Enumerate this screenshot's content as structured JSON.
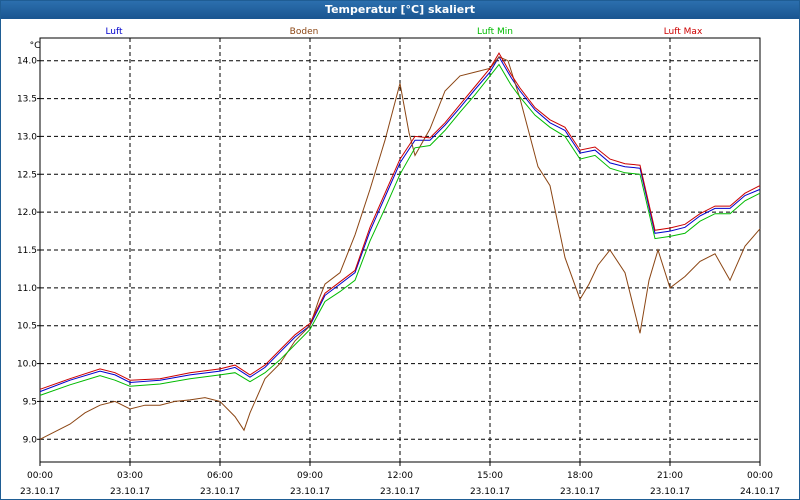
{
  "window": {
    "title": "Temperatur [°C] skaliert"
  },
  "chart_data": {
    "type": "line",
    "title": "Temperatur [°C] skaliert",
    "ylabel": "°C",
    "ylim": [
      8.7,
      14.3
    ],
    "y_ticks": [
      {
        "value": 9.0,
        "label": "9.0"
      },
      {
        "value": 9.5,
        "label": "9.5"
      },
      {
        "value": 10.0,
        "label": "10.0"
      },
      {
        "value": 10.5,
        "label": "10.5"
      },
      {
        "value": 11.0,
        "label": "11.0"
      },
      {
        "value": 11.5,
        "label": "11.5"
      },
      {
        "value": 12.0,
        "label": "12.0"
      },
      {
        "value": 12.5,
        "label": "12.5"
      },
      {
        "value": 13.0,
        "label": "13.0"
      },
      {
        "value": 13.5,
        "label": "13.5"
      },
      {
        "value": 14.0,
        "label": "14.0"
      }
    ],
    "xlim": [
      0,
      24
    ],
    "x_ticks": [
      {
        "hour": 0,
        "time": "00:00",
        "date": "23.10.17"
      },
      {
        "hour": 3,
        "time": "03:00",
        "date": "23.10.17"
      },
      {
        "hour": 6,
        "time": "06:00",
        "date": "23.10.17"
      },
      {
        "hour": 9,
        "time": "09:00",
        "date": "23.10.17"
      },
      {
        "hour": 12,
        "time": "12:00",
        "date": "23.10.17"
      },
      {
        "hour": 15,
        "time": "15:00",
        "date": "23.10.17"
      },
      {
        "hour": 18,
        "time": "18:00",
        "date": "23.10.17"
      },
      {
        "hour": 21,
        "time": "21:00",
        "date": "23.10.17"
      },
      {
        "hour": 24,
        "time": "00:00",
        "date": "24.10.17"
      }
    ],
    "grid": true,
    "legend_position": "top",
    "series": [
      {
        "name": "Luft",
        "color": "#0000cc",
        "x": [
          0,
          1,
          2,
          2.5,
          3,
          4,
          5,
          6,
          6.5,
          7,
          7.5,
          8,
          8.5,
          9,
          9.5,
          10,
          10.5,
          11,
          11.5,
          12,
          12.5,
          13,
          13.5,
          14,
          14.5,
          15,
          15.3,
          15.7,
          16,
          16.5,
          17,
          17.5,
          18,
          18.5,
          19,
          19.5,
          20,
          20.5,
          21,
          21.5,
          22,
          22.5,
          23,
          23.5,
          24
        ],
        "y": [
          9.63,
          9.78,
          9.9,
          9.85,
          9.75,
          9.78,
          9.85,
          9.9,
          9.95,
          9.82,
          9.95,
          10.15,
          10.35,
          10.5,
          10.9,
          11.05,
          11.2,
          11.75,
          12.2,
          12.65,
          12.95,
          12.95,
          13.15,
          13.38,
          13.62,
          13.85,
          14.05,
          13.78,
          13.6,
          13.35,
          13.18,
          13.08,
          12.78,
          12.82,
          12.65,
          12.6,
          12.58,
          11.72,
          11.75,
          11.8,
          11.95,
          12.05,
          12.05,
          12.22,
          12.3
        ]
      },
      {
        "name": "Boden",
        "color": "#8b4513",
        "x": [
          0,
          0.5,
          1,
          1.5,
          2,
          2.5,
          3,
          3.5,
          4,
          4.5,
          5,
          5.5,
          6,
          6.5,
          6.8,
          7,
          7.5,
          8,
          8.5,
          9,
          9.3,
          9.5,
          10,
          10.5,
          11,
          11.5,
          12,
          12.3,
          12.5,
          13,
          13.5,
          14,
          14.5,
          15,
          15.3,
          15.6,
          16,
          16.3,
          16.6,
          17,
          17.5,
          18,
          18.3,
          18.6,
          19,
          19.5,
          20,
          20.3,
          20.6,
          21,
          21.5,
          22,
          22.5,
          23,
          23.5,
          24
        ],
        "y": [
          9.0,
          9.1,
          9.2,
          9.35,
          9.45,
          9.5,
          9.4,
          9.45,
          9.45,
          9.5,
          9.52,
          9.55,
          9.5,
          9.3,
          9.12,
          9.35,
          9.8,
          10.0,
          10.3,
          10.5,
          10.85,
          11.05,
          11.2,
          11.7,
          12.3,
          12.95,
          13.7,
          13.05,
          12.75,
          13.1,
          13.6,
          13.8,
          13.85,
          13.9,
          14.05,
          14.0,
          13.5,
          13.05,
          12.6,
          12.35,
          11.4,
          10.85,
          11.05,
          11.3,
          11.5,
          11.2,
          10.4,
          11.1,
          11.5,
          11.0,
          11.15,
          11.35,
          11.45,
          11.1,
          11.55,
          11.78
        ]
      },
      {
        "name": "Luft Min",
        "color": "#00bb00",
        "x": [
          0,
          1,
          2,
          2.5,
          3,
          4,
          5,
          6,
          6.5,
          7,
          7.5,
          8,
          8.5,
          9,
          9.5,
          10,
          10.5,
          11,
          11.5,
          12,
          12.5,
          13,
          13.5,
          14,
          14.5,
          15,
          15.3,
          15.7,
          16,
          16.5,
          17,
          17.5,
          18,
          18.5,
          19,
          19.5,
          20,
          20.5,
          21,
          21.5,
          22,
          22.5,
          23,
          23.5,
          24
        ],
        "y": [
          9.58,
          9.72,
          9.84,
          9.78,
          9.7,
          9.73,
          9.8,
          9.85,
          9.88,
          9.76,
          9.88,
          10.05,
          10.25,
          10.45,
          10.82,
          10.95,
          11.1,
          11.62,
          12.05,
          12.5,
          12.85,
          12.88,
          13.08,
          13.32,
          13.55,
          13.8,
          13.95,
          13.68,
          13.52,
          13.28,
          13.12,
          13.0,
          12.7,
          12.75,
          12.58,
          12.52,
          12.5,
          11.65,
          11.68,
          11.72,
          11.88,
          11.98,
          11.98,
          12.15,
          12.25
        ]
      },
      {
        "name": "Luft Max",
        "color": "#cc0000",
        "x": [
          0,
          1,
          2,
          2.5,
          3,
          4,
          5,
          6,
          6.5,
          7,
          7.5,
          8,
          8.5,
          9,
          9.5,
          10,
          10.5,
          11,
          11.5,
          12,
          12.5,
          13,
          13.5,
          14,
          14.5,
          15,
          15.3,
          15.7,
          16,
          16.5,
          17,
          17.5,
          18,
          18.5,
          19,
          19.5,
          20,
          20.5,
          21,
          21.5,
          22,
          22.5,
          23,
          23.5,
          24
        ],
        "y": [
          9.66,
          9.8,
          9.93,
          9.88,
          9.78,
          9.8,
          9.88,
          9.93,
          9.98,
          9.85,
          9.98,
          10.18,
          10.38,
          10.53,
          10.93,
          11.08,
          11.23,
          11.8,
          12.25,
          12.7,
          13.0,
          12.98,
          13.18,
          13.42,
          13.66,
          13.9,
          14.1,
          13.82,
          13.64,
          13.38,
          13.22,
          13.12,
          12.82,
          12.86,
          12.7,
          12.64,
          12.62,
          11.76,
          11.79,
          11.84,
          11.98,
          12.08,
          12.08,
          12.25,
          12.35
        ]
      }
    ]
  }
}
